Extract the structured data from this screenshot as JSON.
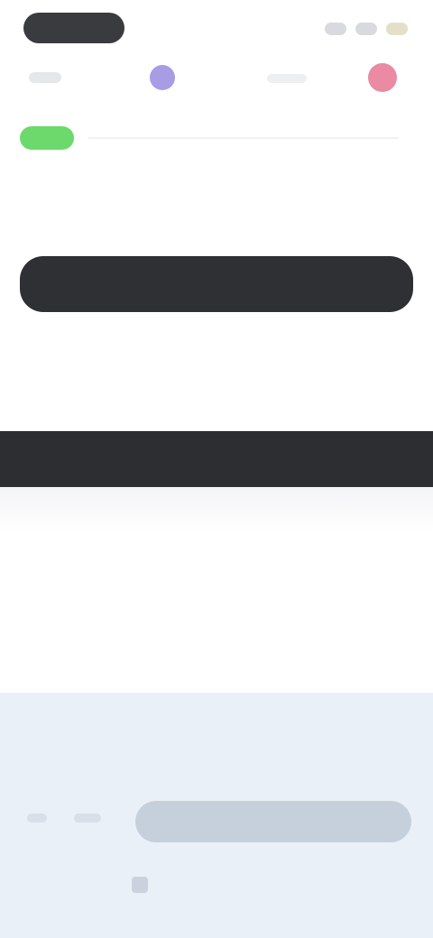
{
  "status_bar": {
    "icons": [
      "signal-icon",
      "wifi-icon",
      "battery-icon"
    ]
  },
  "header": {
    "back_icon": "back-icon",
    "logo_icon": "logo-icon",
    "brand_name": "",
    "avatar_icon": "avatar-icon"
  },
  "content": {
    "badge_label": "",
    "description": "",
    "primary_button_label": "",
    "note": ""
  },
  "banner": {
    "text": ""
  },
  "footer": {
    "links": [
      "",
      ""
    ],
    "button_label": "",
    "secure_text": ""
  },
  "colors": {
    "badge": "#6bd96b",
    "primary_button": "#2f3033",
    "banner": "#2d2e31",
    "footer_bg": "#eaf0f7",
    "avatar": "#e56d8c",
    "logo": "#8b7bdc"
  }
}
